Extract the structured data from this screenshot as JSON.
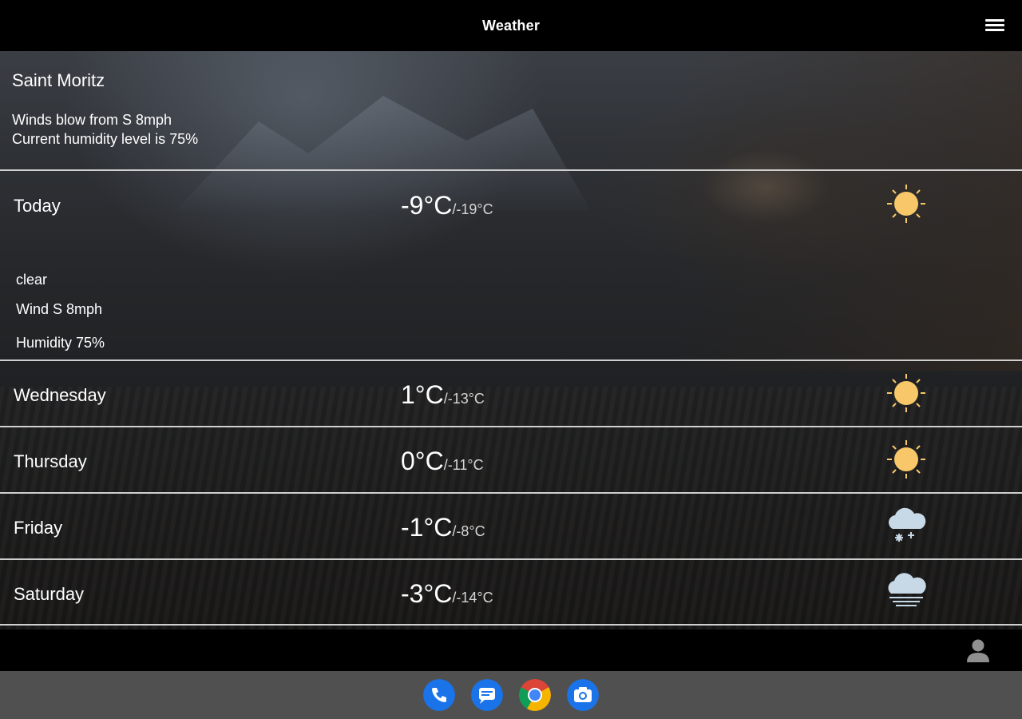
{
  "app": {
    "title": "Weather"
  },
  "location": {
    "city": "Saint Moritz",
    "wind_summary": "Winds blow from S 8mph",
    "humidity_summary": "Current humidity level is 75%"
  },
  "today": {
    "day": "Today",
    "high": "-9°C",
    "low": "/-19°C",
    "condition": "clear",
    "wind": "Wind S 8mph",
    "humidity": "Humidity 75%",
    "icon": "sun-icon"
  },
  "forecast": [
    {
      "day": "Wednesday",
      "high": "1°C",
      "low": "/-13°C",
      "icon": "sun-icon"
    },
    {
      "day": "Thursday",
      "high": "0°C",
      "low": "/-11°C",
      "icon": "sun-icon"
    },
    {
      "day": "Friday",
      "high": "-1°C",
      "low": "/-8°C",
      "icon": "snow-cloud-icon"
    },
    {
      "day": "Saturday",
      "high": "-3°C",
      "low": "/-14°C",
      "icon": "fog-cloud-icon"
    }
  ],
  "colors": {
    "sun": "#f7c76a",
    "cloud": "#c7d8e6",
    "divider": "#cfcfcf",
    "dock": "#505050",
    "app_blue": "#1a73e8"
  },
  "dock": [
    {
      "icon": "phone-icon"
    },
    {
      "icon": "messages-icon"
    },
    {
      "icon": "chrome-icon"
    },
    {
      "icon": "camera-icon"
    }
  ]
}
